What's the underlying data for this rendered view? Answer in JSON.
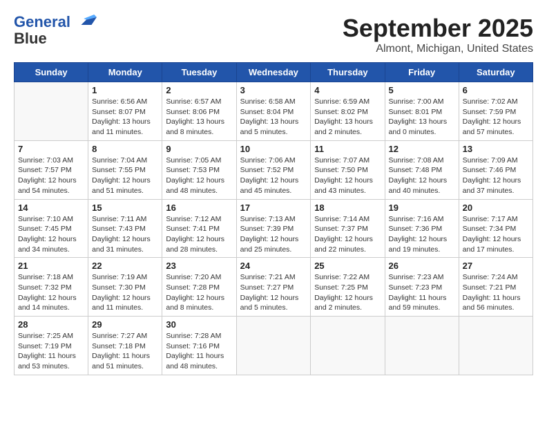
{
  "header": {
    "logo_line1": "General",
    "logo_line2": "Blue",
    "month": "September 2025",
    "location": "Almont, Michigan, United States"
  },
  "weekdays": [
    "Sunday",
    "Monday",
    "Tuesday",
    "Wednesday",
    "Thursday",
    "Friday",
    "Saturday"
  ],
  "weeks": [
    [
      {
        "day": "",
        "info": ""
      },
      {
        "day": "1",
        "info": "Sunrise: 6:56 AM\nSunset: 8:07 PM\nDaylight: 13 hours\nand 11 minutes."
      },
      {
        "day": "2",
        "info": "Sunrise: 6:57 AM\nSunset: 8:06 PM\nDaylight: 13 hours\nand 8 minutes."
      },
      {
        "day": "3",
        "info": "Sunrise: 6:58 AM\nSunset: 8:04 PM\nDaylight: 13 hours\nand 5 minutes."
      },
      {
        "day": "4",
        "info": "Sunrise: 6:59 AM\nSunset: 8:02 PM\nDaylight: 13 hours\nand 2 minutes."
      },
      {
        "day": "5",
        "info": "Sunrise: 7:00 AM\nSunset: 8:01 PM\nDaylight: 13 hours\nand 0 minutes."
      },
      {
        "day": "6",
        "info": "Sunrise: 7:02 AM\nSunset: 7:59 PM\nDaylight: 12 hours\nand 57 minutes."
      }
    ],
    [
      {
        "day": "7",
        "info": "Sunrise: 7:03 AM\nSunset: 7:57 PM\nDaylight: 12 hours\nand 54 minutes."
      },
      {
        "day": "8",
        "info": "Sunrise: 7:04 AM\nSunset: 7:55 PM\nDaylight: 12 hours\nand 51 minutes."
      },
      {
        "day": "9",
        "info": "Sunrise: 7:05 AM\nSunset: 7:53 PM\nDaylight: 12 hours\nand 48 minutes."
      },
      {
        "day": "10",
        "info": "Sunrise: 7:06 AM\nSunset: 7:52 PM\nDaylight: 12 hours\nand 45 minutes."
      },
      {
        "day": "11",
        "info": "Sunrise: 7:07 AM\nSunset: 7:50 PM\nDaylight: 12 hours\nand 43 minutes."
      },
      {
        "day": "12",
        "info": "Sunrise: 7:08 AM\nSunset: 7:48 PM\nDaylight: 12 hours\nand 40 minutes."
      },
      {
        "day": "13",
        "info": "Sunrise: 7:09 AM\nSunset: 7:46 PM\nDaylight: 12 hours\nand 37 minutes."
      }
    ],
    [
      {
        "day": "14",
        "info": "Sunrise: 7:10 AM\nSunset: 7:45 PM\nDaylight: 12 hours\nand 34 minutes."
      },
      {
        "day": "15",
        "info": "Sunrise: 7:11 AM\nSunset: 7:43 PM\nDaylight: 12 hours\nand 31 minutes."
      },
      {
        "day": "16",
        "info": "Sunrise: 7:12 AM\nSunset: 7:41 PM\nDaylight: 12 hours\nand 28 minutes."
      },
      {
        "day": "17",
        "info": "Sunrise: 7:13 AM\nSunset: 7:39 PM\nDaylight: 12 hours\nand 25 minutes."
      },
      {
        "day": "18",
        "info": "Sunrise: 7:14 AM\nSunset: 7:37 PM\nDaylight: 12 hours\nand 22 minutes."
      },
      {
        "day": "19",
        "info": "Sunrise: 7:16 AM\nSunset: 7:36 PM\nDaylight: 12 hours\nand 19 minutes."
      },
      {
        "day": "20",
        "info": "Sunrise: 7:17 AM\nSunset: 7:34 PM\nDaylight: 12 hours\nand 17 minutes."
      }
    ],
    [
      {
        "day": "21",
        "info": "Sunrise: 7:18 AM\nSunset: 7:32 PM\nDaylight: 12 hours\nand 14 minutes."
      },
      {
        "day": "22",
        "info": "Sunrise: 7:19 AM\nSunset: 7:30 PM\nDaylight: 12 hours\nand 11 minutes."
      },
      {
        "day": "23",
        "info": "Sunrise: 7:20 AM\nSunset: 7:28 PM\nDaylight: 12 hours\nand 8 minutes."
      },
      {
        "day": "24",
        "info": "Sunrise: 7:21 AM\nSunset: 7:27 PM\nDaylight: 12 hours\nand 5 minutes."
      },
      {
        "day": "25",
        "info": "Sunrise: 7:22 AM\nSunset: 7:25 PM\nDaylight: 12 hours\nand 2 minutes."
      },
      {
        "day": "26",
        "info": "Sunrise: 7:23 AM\nSunset: 7:23 PM\nDaylight: 11 hours\nand 59 minutes."
      },
      {
        "day": "27",
        "info": "Sunrise: 7:24 AM\nSunset: 7:21 PM\nDaylight: 11 hours\nand 56 minutes."
      }
    ],
    [
      {
        "day": "28",
        "info": "Sunrise: 7:25 AM\nSunset: 7:19 PM\nDaylight: 11 hours\nand 53 minutes."
      },
      {
        "day": "29",
        "info": "Sunrise: 7:27 AM\nSunset: 7:18 PM\nDaylight: 11 hours\nand 51 minutes."
      },
      {
        "day": "30",
        "info": "Sunrise: 7:28 AM\nSunset: 7:16 PM\nDaylight: 11 hours\nand 48 minutes."
      },
      {
        "day": "",
        "info": ""
      },
      {
        "day": "",
        "info": ""
      },
      {
        "day": "",
        "info": ""
      },
      {
        "day": "",
        "info": ""
      }
    ]
  ]
}
